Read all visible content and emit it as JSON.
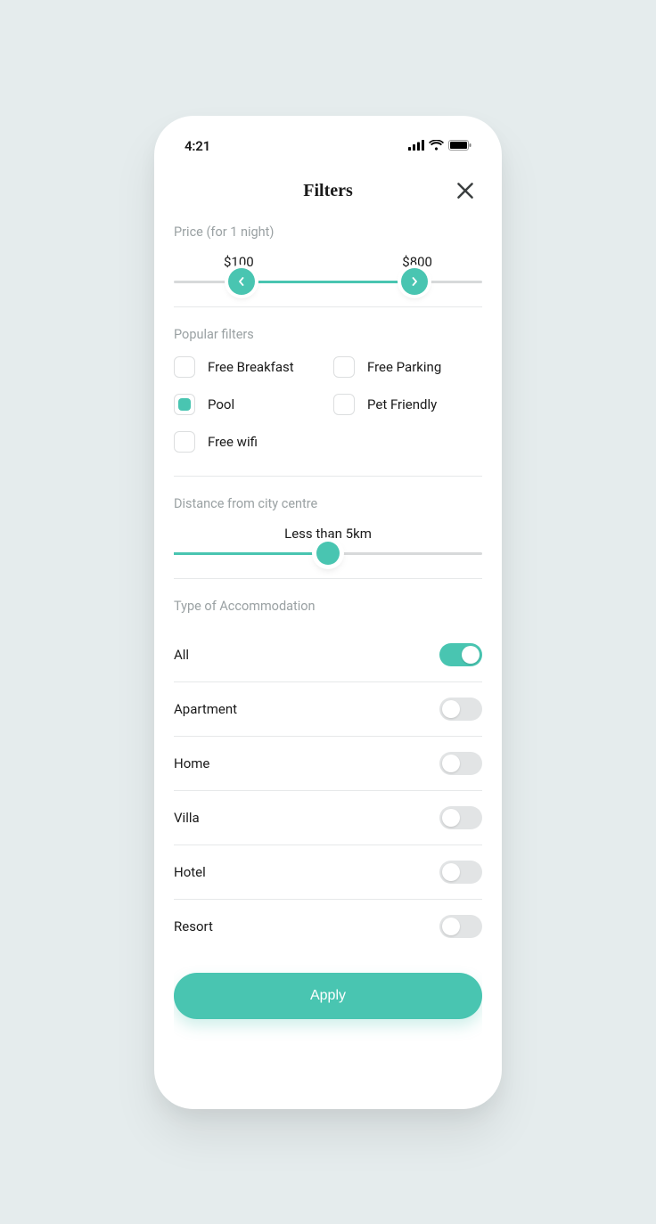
{
  "statusbar": {
    "time": "4:21"
  },
  "header": {
    "title": "Filters"
  },
  "price": {
    "label": "Price (for 1 night)",
    "min_display": "$100",
    "max_display": "$800"
  },
  "popular": {
    "label": "Popular filters",
    "items": [
      {
        "label": "Free Breakfast",
        "checked": false
      },
      {
        "label": "Free Parking",
        "checked": false
      },
      {
        "label": "Pool",
        "checked": true
      },
      {
        "label": "Pet Friendly",
        "checked": false
      },
      {
        "label": "Free wifi",
        "checked": false
      }
    ]
  },
  "distance": {
    "label": "Distance from city centre",
    "value_display": "Less than 5km"
  },
  "accommodation": {
    "label": "Type of Accommodation",
    "items": [
      {
        "label": "All",
        "on": true
      },
      {
        "label": "Apartment",
        "on": false
      },
      {
        "label": "Home",
        "on": false
      },
      {
        "label": "Villa",
        "on": false
      },
      {
        "label": "Hotel",
        "on": false
      },
      {
        "label": "Resort",
        "on": false
      }
    ]
  },
  "actions": {
    "apply": "Apply"
  },
  "colors": {
    "accent": "#49c5b1",
    "muted": "#9aa1a3"
  }
}
